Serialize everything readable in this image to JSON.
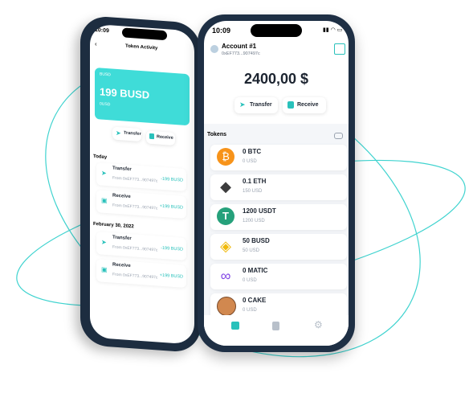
{
  "back_phone": {
    "status_time": "10:09",
    "header_title": "Token Activity",
    "card": {
      "symbol": "BUSD",
      "amount": "199 BUSD",
      "sub": "0USD"
    },
    "buttons": {
      "transfer": "Transfer",
      "receive": "Receive"
    },
    "groups": [
      {
        "label": "Today",
        "items": [
          {
            "type": "Transfer",
            "from": "From 0xEF773...907497c",
            "amount": "-199 BUSD"
          },
          {
            "type": "Receive",
            "from": "From 0xEF773...907497c",
            "amount": "+199 BUSD"
          }
        ]
      },
      {
        "label": "February 30, 2022",
        "items": [
          {
            "type": "Transfer",
            "from": "From 0xEF773...907497c",
            "amount": "-199 BUSD"
          },
          {
            "type": "Receive",
            "from": "From 0xEF773...907497c",
            "amount": "+199 BUSD"
          }
        ]
      }
    ]
  },
  "front_phone": {
    "status_time": "10:09",
    "account_name": "Account #1",
    "account_address": "0xEF773...907497c",
    "balance": "2400,00 $",
    "buttons": {
      "transfer": "Transfer",
      "receive": "Receive"
    },
    "tokens_label": "Tokens",
    "tokens": [
      {
        "name": "0 BTC",
        "usd": "0 USD",
        "color": "#f7931a",
        "icon": "bitcoin-icon"
      },
      {
        "name": "0.1 ETH",
        "usd": "150 USD",
        "color": "#3c3c3d",
        "icon": "ethereum-icon"
      },
      {
        "name": "1200 USDT",
        "usd": "1200 USD",
        "color": "#26a17b",
        "icon": "tether-icon"
      },
      {
        "name": "50 BUSD",
        "usd": "50 USD",
        "color": "#f0b90b",
        "icon": "busd-icon"
      },
      {
        "name": "0 MATIC",
        "usd": "0 USD",
        "color": "#8247e5",
        "icon": "matic-icon"
      },
      {
        "name": "0 CAKE",
        "usd": "0 USD",
        "color": "#d1884f",
        "icon": "cake-icon"
      }
    ],
    "accent": "#29c1bb"
  }
}
